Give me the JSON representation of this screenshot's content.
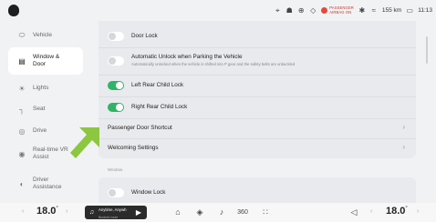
{
  "status": {
    "airbag_line1": "PASSENGER",
    "airbag_line2": "AIRBAG ON",
    "range": "155 km",
    "time": "11:13",
    "icons": [
      "location-icon",
      "steering-icon",
      "seat-heat-icon",
      "tire-icon",
      "airbag-icon",
      "bluetooth-icon",
      "wifi-icon",
      "battery-icon"
    ]
  },
  "sidebar": {
    "items": [
      {
        "label": "Vehicle",
        "icon": "car-icon"
      },
      {
        "label": "Window & Door",
        "label_line1": "Window &",
        "label_line2": "Door",
        "icon": "door-icon",
        "active": true
      },
      {
        "label": "Lights",
        "icon": "light-icon"
      },
      {
        "label": "Seat",
        "icon": "seat-icon"
      },
      {
        "label": "Drive",
        "icon": "drive-icon"
      },
      {
        "label": "Real-time VR Assist",
        "label_line1": "Real-time VR",
        "label_line2": "Assist",
        "icon": "vr-icon"
      },
      {
        "label": "Driver Assistance",
        "label_line1": "Driver",
        "label_line2": "Assistance",
        "icon": "assist-icon"
      }
    ]
  },
  "settings": {
    "door_lock": {
      "label": "Door Lock",
      "on": false
    },
    "auto_unlock": {
      "label": "Automatic Unlock when Parking the Vehicle",
      "sub": "Automatically unlocked when the vehicle is shifted into P gear and the safety belts are unbuckled",
      "on": false
    },
    "left_rear_child_lock": {
      "label": "Left Rear Child Lock",
      "on": true
    },
    "right_rear_child_lock": {
      "label": "Right Rear Child Lock",
      "on": true
    },
    "passenger_door_shortcut": {
      "label": "Passenger Door Shortcut"
    },
    "welcoming_settings": {
      "label": "Welcoming Settings"
    },
    "window_section_title": "Window",
    "window_lock": {
      "label": "Window Lock",
      "on": false
    }
  },
  "dock": {
    "left_temp": "18.0",
    "right_temp": "18.0",
    "degree": "°",
    "media_title": "Anytime, Anywh",
    "media_sub": "Booked route",
    "icons": [
      "music-note-icon",
      "home-icon",
      "car-front-icon",
      "music-icon",
      "360-icon",
      "apps-icon",
      "volume-icon"
    ]
  },
  "colors": {
    "toggle_on": "#2fb465",
    "accent_arrow": "#8dc63f",
    "airbag": "#e24a3b"
  }
}
